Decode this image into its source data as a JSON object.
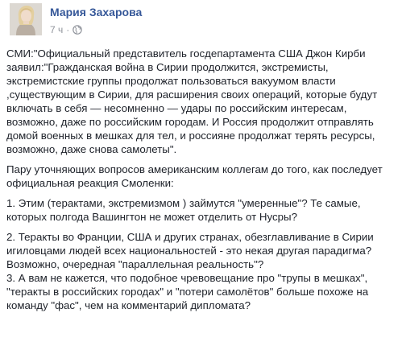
{
  "post": {
    "author_name": "Мария Захарова",
    "timestamp": "7 ч",
    "separator": "·",
    "privacy_icon": "globe-icon",
    "paragraphs": [
      "СМИ:\"Официальный представитель госдепартамента США Джон Кирби заявил:\"Гражданская война в Сирии продолжится, экстремисты, экстремистские группы продолжат пользоваться вакуумом власти ,существующим в Сирии, для расширения своих операций, которые будут включать в себя — несомненно — удары по российским интересам, возможно, даже по российским городам. И Россия продолжит отправлять домой военных в мешках для тел, и россияне продолжат терять ресурсы, возможно, даже снова самолеты\".",
      "Пару уточняющих вопросов американским коллегам до того, как последует официальная реакция Смоленки:",
      "1. Этим (терактами, экстремизмом ) займутся \"умеренные\"? Те самые, которых полгода Вашингтон не может отделить от Нусры?",
      "2. Теракты во Франции, США и других странах, обезглавливание в Сирии игиловцами людей всех национальностей - это некая другая парадигма? Возможно, очередная \"параллельная реальность\"?\n3. А вам не кажется, что подобное чревовещание про \"трупы в мешках\", \"теракты в российских городах\" и \"потери самолётов\" больше похоже на команду \"фас\", чем на комментарий дипломата?"
    ]
  },
  "colors": {
    "author_link": "#365899",
    "meta_text": "#90949c",
    "body_text": "#1d2129"
  }
}
